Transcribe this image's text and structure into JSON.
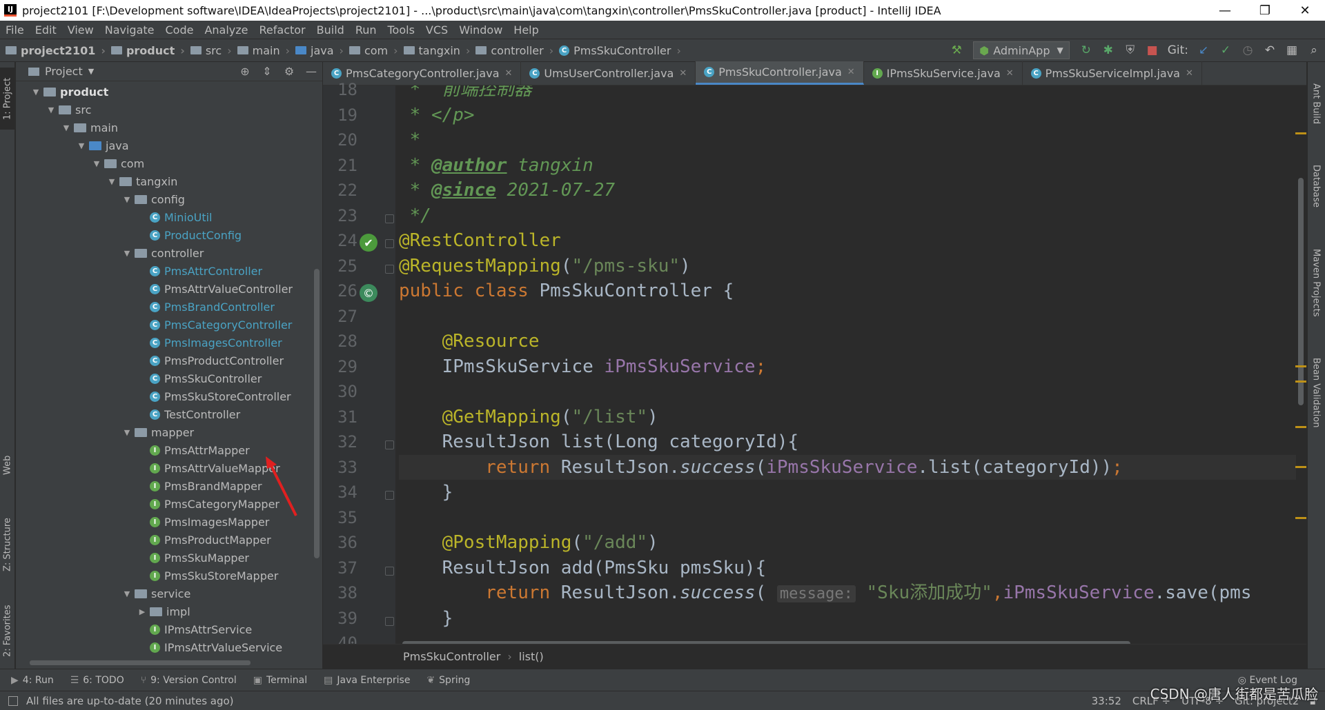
{
  "window": {
    "title": "project2101 [F:\\Development software\\IDEA\\IdeaProjects\\project2101] - ...\\product\\src\\main\\java\\com\\tangxin\\controller\\PmsSkuController.java [product] - IntelliJ IDEA",
    "app_icon": "IJ",
    "minimize": "—",
    "restore": "❐",
    "close": "✕"
  },
  "menu": [
    "File",
    "Edit",
    "View",
    "Navigate",
    "Code",
    "Analyze",
    "Refactor",
    "Build",
    "Run",
    "Tools",
    "VCS",
    "Window",
    "Help"
  ],
  "breadcrumbs": [
    "project2101",
    "product",
    "src",
    "main",
    "java",
    "com",
    "tangxin",
    "controller",
    "PmsSkuController"
  ],
  "toolbar": {
    "run_config": "AdminApp",
    "git_label": "Git:",
    "icons": [
      "hammer-icon",
      "run-icon",
      "debug-icon",
      "coverage-icon",
      "stop-icon",
      "git-update-icon",
      "git-commit-icon",
      "history-icon",
      "revert-icon",
      "project-structure-icon",
      "search-icon"
    ]
  },
  "project_panel": {
    "title": "Project",
    "tree": [
      {
        "label": "product",
        "depth": 0,
        "type": "folder",
        "expanded": true,
        "bold": true
      },
      {
        "label": "src",
        "depth": 1,
        "type": "folder",
        "expanded": true
      },
      {
        "label": "main",
        "depth": 2,
        "type": "folder",
        "expanded": true
      },
      {
        "label": "java",
        "depth": 3,
        "type": "folder-blue",
        "expanded": true
      },
      {
        "label": "com",
        "depth": 4,
        "type": "folder",
        "expanded": true
      },
      {
        "label": "tangxin",
        "depth": 5,
        "type": "folder",
        "expanded": true
      },
      {
        "label": "config",
        "depth": 6,
        "type": "folder",
        "expanded": true
      },
      {
        "label": "MinioUtil",
        "depth": 7,
        "type": "class",
        "modified": true
      },
      {
        "label": "ProductConfig",
        "depth": 7,
        "type": "class",
        "modified": true
      },
      {
        "label": "controller",
        "depth": 6,
        "type": "folder",
        "expanded": true
      },
      {
        "label": "PmsAttrController",
        "depth": 7,
        "type": "class",
        "modified": true
      },
      {
        "label": "PmsAttrValueController",
        "depth": 7,
        "type": "class"
      },
      {
        "label": "PmsBrandController",
        "depth": 7,
        "type": "class",
        "modified": true
      },
      {
        "label": "PmsCategoryController",
        "depth": 7,
        "type": "class",
        "modified": true
      },
      {
        "label": "PmsImagesController",
        "depth": 7,
        "type": "class",
        "modified": true
      },
      {
        "label": "PmsProductController",
        "depth": 7,
        "type": "class"
      },
      {
        "label": "PmsSkuController",
        "depth": 7,
        "type": "class"
      },
      {
        "label": "PmsSkuStoreController",
        "depth": 7,
        "type": "class"
      },
      {
        "label": "TestController",
        "depth": 7,
        "type": "class"
      },
      {
        "label": "mapper",
        "depth": 6,
        "type": "folder",
        "expanded": true
      },
      {
        "label": "PmsAttrMapper",
        "depth": 7,
        "type": "interface"
      },
      {
        "label": "PmsAttrValueMapper",
        "depth": 7,
        "type": "interface"
      },
      {
        "label": "PmsBrandMapper",
        "depth": 7,
        "type": "interface"
      },
      {
        "label": "PmsCategoryMapper",
        "depth": 7,
        "type": "interface"
      },
      {
        "label": "PmsImagesMapper",
        "depth": 7,
        "type": "interface"
      },
      {
        "label": "PmsProductMapper",
        "depth": 7,
        "type": "interface"
      },
      {
        "label": "PmsSkuMapper",
        "depth": 7,
        "type": "interface"
      },
      {
        "label": "PmsSkuStoreMapper",
        "depth": 7,
        "type": "interface"
      },
      {
        "label": "service",
        "depth": 6,
        "type": "folder",
        "expanded": true
      },
      {
        "label": "impl",
        "depth": 7,
        "type": "folder",
        "expanded": false
      },
      {
        "label": "IPmsAttrService",
        "depth": 7,
        "type": "interface"
      },
      {
        "label": "IPmsAttrValueService",
        "depth": 7,
        "type": "interface"
      }
    ]
  },
  "left_tool_tabs": [
    "1: Project",
    "Web",
    "Z: Structure",
    "2: Favorites"
  ],
  "right_tool_tabs": [
    "Ant Build",
    "Database",
    "Maven Projects",
    "Bean Validation"
  ],
  "editor_tabs": [
    {
      "label": "PmsCategoryController.java",
      "icon": "c",
      "active": false
    },
    {
      "label": "UmsUserController.java",
      "icon": "c",
      "active": false
    },
    {
      "label": "PmsSkuController.java",
      "icon": "c",
      "active": true
    },
    {
      "label": "IPmsSkuService.java",
      "icon": "i",
      "active": false
    },
    {
      "label": "PmsSkuServiceImpl.java",
      "icon": "c",
      "active": false
    }
  ],
  "code": {
    "lines": [
      {
        "n": "18",
        "tokens": [
          [
            "cm",
            " *  "
          ],
          [
            "cm",
            "前端控制器"
          ]
        ]
      },
      {
        "n": "19",
        "tokens": [
          [
            "cm",
            " * </p>"
          ]
        ]
      },
      {
        "n": "20",
        "tokens": [
          [
            "cm",
            " *"
          ]
        ]
      },
      {
        "n": "21",
        "tokens": [
          [
            "cm",
            " * "
          ],
          [
            "cmb",
            "@author"
          ],
          [
            "cm",
            " tangxin"
          ]
        ]
      },
      {
        "n": "22",
        "tokens": [
          [
            "cm",
            " * "
          ],
          [
            "cmb",
            "@since"
          ],
          [
            "cm",
            " 2021-07-27"
          ]
        ]
      },
      {
        "n": "23",
        "tokens": [
          [
            "cm",
            " */"
          ]
        ]
      },
      {
        "n": "24",
        "tokens": [
          [
            "an",
            "@RestController"
          ]
        ]
      },
      {
        "n": "25",
        "tokens": [
          [
            "an",
            "@RequestMapping"
          ],
          [
            "pl",
            "("
          ],
          [
            "st",
            "\"/pms-sku\""
          ],
          [
            "pl",
            ")"
          ]
        ]
      },
      {
        "n": "26",
        "tokens": [
          [
            "kw",
            "public class "
          ],
          [
            "pl",
            "PmsSkuController {"
          ]
        ]
      },
      {
        "n": "27",
        "tokens": []
      },
      {
        "n": "28",
        "tokens": [
          [
            "pl",
            "    "
          ],
          [
            "an",
            "@Resource"
          ]
        ]
      },
      {
        "n": "29",
        "tokens": [
          [
            "pl",
            "    IPmsSkuService "
          ],
          [
            "fd",
            "iPmsSkuService"
          ],
          [
            "kw",
            ";"
          ]
        ]
      },
      {
        "n": "30",
        "tokens": []
      },
      {
        "n": "31",
        "tokens": [
          [
            "pl",
            "    "
          ],
          [
            "an",
            "@GetMapping"
          ],
          [
            "pl",
            "("
          ],
          [
            "st",
            "\"/list\""
          ],
          [
            "pl",
            ")"
          ]
        ]
      },
      {
        "n": "32",
        "tokens": [
          [
            "pl",
            "    ResultJson list(Long categoryId){"
          ]
        ]
      },
      {
        "n": "33",
        "tokens": [
          [
            "pl",
            "        "
          ],
          [
            "kw",
            "return "
          ],
          [
            "pl",
            "ResultJson."
          ],
          [
            "it",
            "success"
          ],
          [
            "pl",
            "("
          ],
          [
            "fd",
            "iPmsSkuService"
          ],
          [
            "pl",
            ".list(categoryId))"
          ],
          [
            "kw",
            ";"
          ]
        ],
        "current": true
      },
      {
        "n": "34",
        "tokens": [
          [
            "pl",
            "    }"
          ]
        ]
      },
      {
        "n": "35",
        "tokens": []
      },
      {
        "n": "36",
        "tokens": [
          [
            "pl",
            "    "
          ],
          [
            "an",
            "@PostMapping"
          ],
          [
            "pl",
            "("
          ],
          [
            "st",
            "\"/add\""
          ],
          [
            "pl",
            ")"
          ]
        ]
      },
      {
        "n": "37",
        "tokens": [
          [
            "pl",
            "    ResultJson add(PmsSku pmsSku){"
          ]
        ]
      },
      {
        "n": "38",
        "tokens": [
          [
            "pl",
            "        "
          ],
          [
            "kw",
            "return "
          ],
          [
            "pl",
            "ResultJson."
          ],
          [
            "it",
            "success"
          ],
          [
            "pl",
            "( "
          ],
          [
            "hint",
            "message:"
          ],
          [
            "pl",
            " "
          ],
          [
            "st",
            "\"Sku添加成功\""
          ],
          [
            "kw",
            ","
          ],
          [
            "fd",
            "iPmsSkuService"
          ],
          [
            "pl",
            ".save(pms"
          ]
        ]
      },
      {
        "n": "39",
        "tokens": [
          [
            "pl",
            "    }"
          ]
        ]
      },
      {
        "n": "40",
        "tokens": []
      }
    ]
  },
  "editor_breadcrumb": [
    "PmsSkuController",
    "list()"
  ],
  "bottom_tools": [
    {
      "icon": "▶",
      "label": "4: Run"
    },
    {
      "icon": "☰",
      "label": "6: TODO"
    },
    {
      "icon": "⑂",
      "label": "9: Version Control"
    },
    {
      "icon": "▣",
      "label": "Terminal"
    },
    {
      "icon": "▤",
      "label": "Java Enterprise"
    },
    {
      "icon": "❦",
      "label": "Spring"
    }
  ],
  "event_log": "Event Log",
  "status": {
    "message": "All files are up-to-date (20 minutes ago)",
    "position": "33:52",
    "line_sep": "CRLF ÷",
    "encoding": "UTF-8 ÷",
    "git_branch": "Git: project2"
  },
  "watermark": "CSDN @唐人街都是苦瓜脸",
  "colors": {
    "accent": "#4a88c7",
    "arrow": "#e02020"
  }
}
